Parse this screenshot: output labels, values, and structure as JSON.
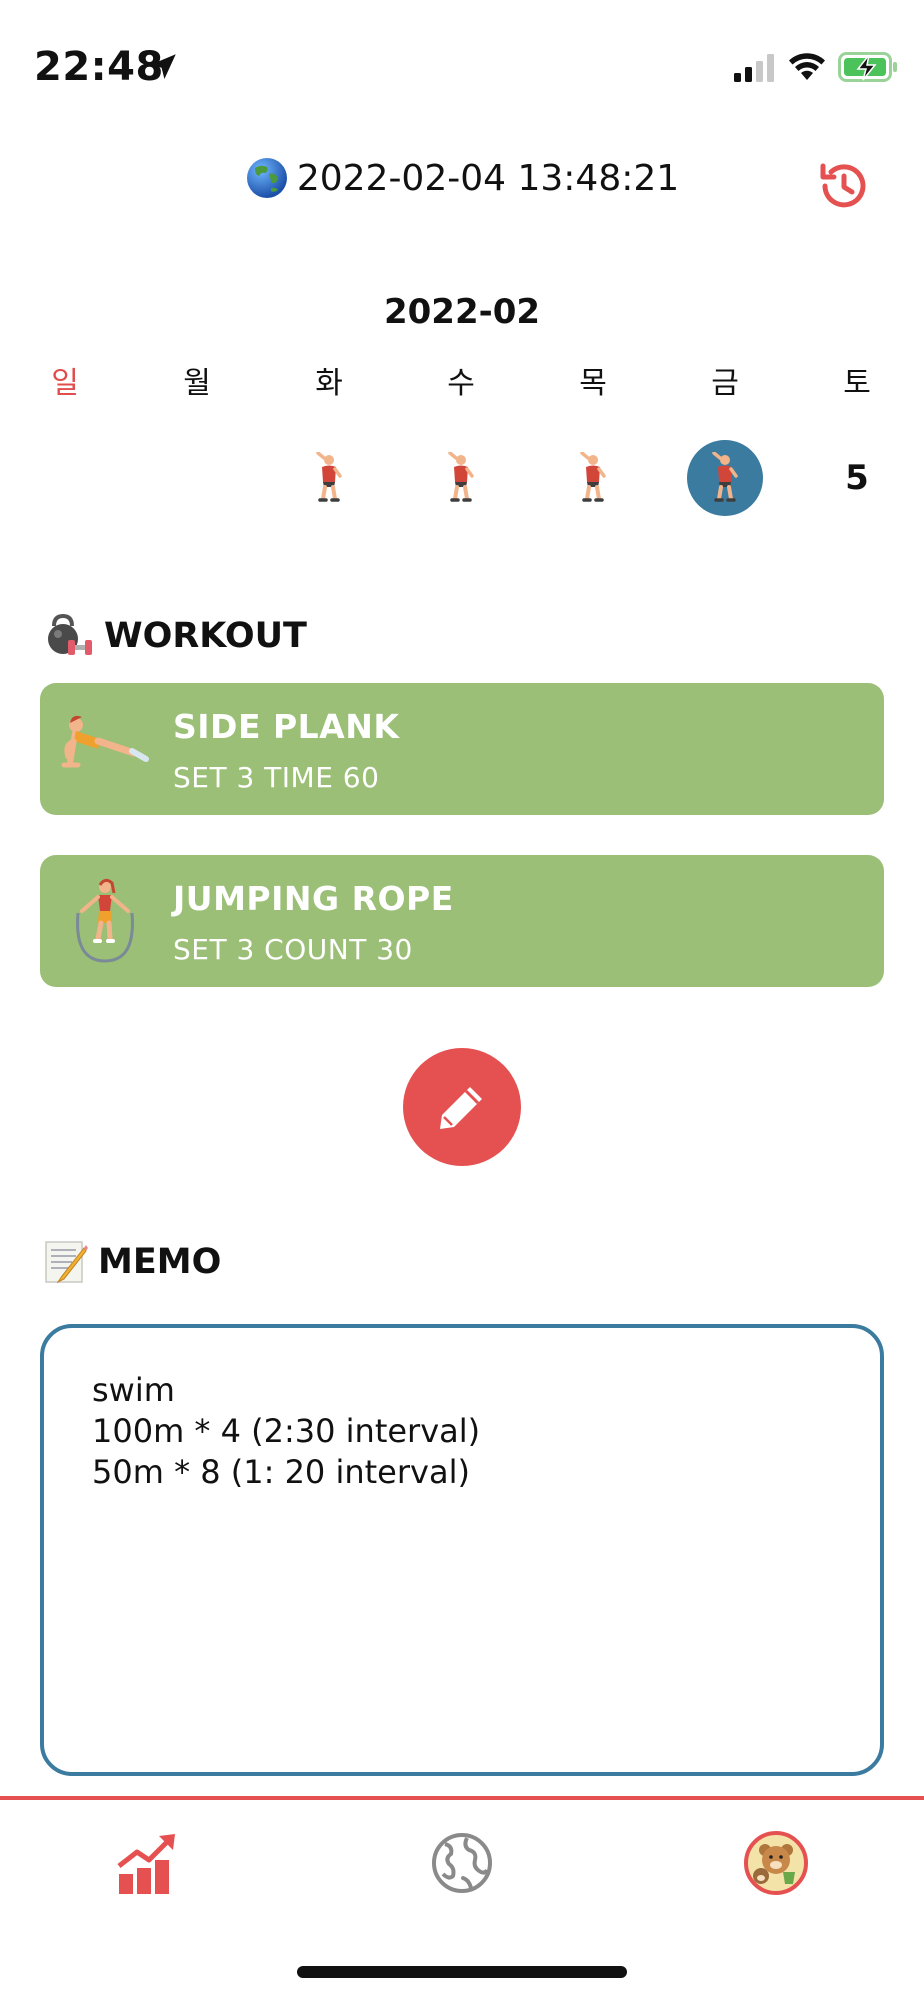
{
  "status_bar": {
    "time": "22:48",
    "icons": [
      "location-arrow-icon",
      "signal-icon",
      "wifi-icon",
      "battery-charging-icon"
    ]
  },
  "header": {
    "datetime": "2022-02-04 13:48:21",
    "globe_icon": "globe-asia-emoji",
    "history_icon": "history-icon",
    "accent_color": "#e55150"
  },
  "calendar": {
    "month": "2022-02",
    "weekdays": [
      "일",
      "월",
      "화",
      "수",
      "목",
      "금",
      "토"
    ],
    "days": [
      {
        "weekday": "화",
        "marker": "workout-person-icon"
      },
      {
        "weekday": "수",
        "marker": "workout-person-icon"
      },
      {
        "weekday": "목",
        "marker": "workout-person-icon"
      },
      {
        "weekday": "금",
        "marker": "workout-person-icon",
        "selected": true
      },
      {
        "weekday": "토",
        "label": "5"
      }
    ],
    "selected_color": "#3b7ba0"
  },
  "workout": {
    "title": "WORKOUT",
    "title_icon": "kettlebell-dumbbell-icon",
    "card_color": "#9bbf76",
    "items": [
      {
        "name": "SIDE PLANK",
        "detail": "SET 3 TIME 60",
        "icon": "side-plank-icon"
      },
      {
        "name": "JUMPING ROPE",
        "detail": "SET 3 COUNT 30",
        "icon": "jumping-rope-icon"
      }
    ]
  },
  "edit_button": {
    "icon": "pencil-icon",
    "color": "#e55150"
  },
  "memo": {
    "title": "MEMO",
    "title_icon": "memo-emoji",
    "lines": [
      "swim",
      "100m * 4 (2:30 interval)",
      "50m * 8 (1: 20 interval)"
    ],
    "border_color": "#3b7ba0"
  },
  "tab_bar": {
    "items": [
      {
        "icon": "chart-growth-icon",
        "active": true
      },
      {
        "icon": "globe-icon",
        "active": false
      },
      {
        "icon": "bear-avatar-icon",
        "active": false
      }
    ]
  }
}
